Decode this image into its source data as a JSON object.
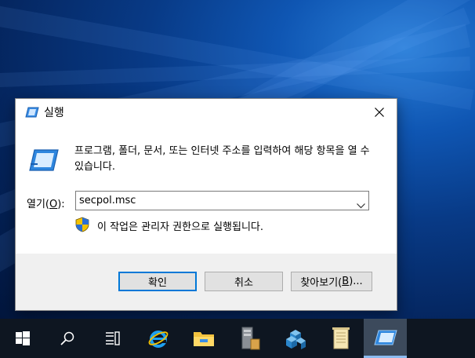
{
  "dialog": {
    "title": "실행",
    "description": "프로그램, 폴더, 문서, 또는 인터넷 주소를 입력하여 해당 항목을 열 수 있습니다.",
    "open_label_prefix": "열기(",
    "open_label_key": "O",
    "open_label_suffix": "):",
    "command_value": "secpol.msc",
    "admin_note": "이 작업은 관리자 권한으로 실행됩니다.",
    "ok_label": "확인",
    "cancel_label": "취소",
    "browse_label_prefix": "찾아보기(",
    "browse_label_key": "B",
    "browse_label_suffix": ")..."
  },
  "taskbar": {
    "items": [
      "start-icon",
      "search-icon",
      "task-view-icon",
      "internet-explorer-icon",
      "file-explorer-icon",
      "server-manager-icon",
      "tool-cubes-icon",
      "notepad-icon",
      "run-dialog-icon"
    ],
    "active": "run-dialog-icon"
  },
  "colors": {
    "desktop": "#083a86",
    "taskbar": "#0e1621",
    "accent": "#0078d7"
  }
}
